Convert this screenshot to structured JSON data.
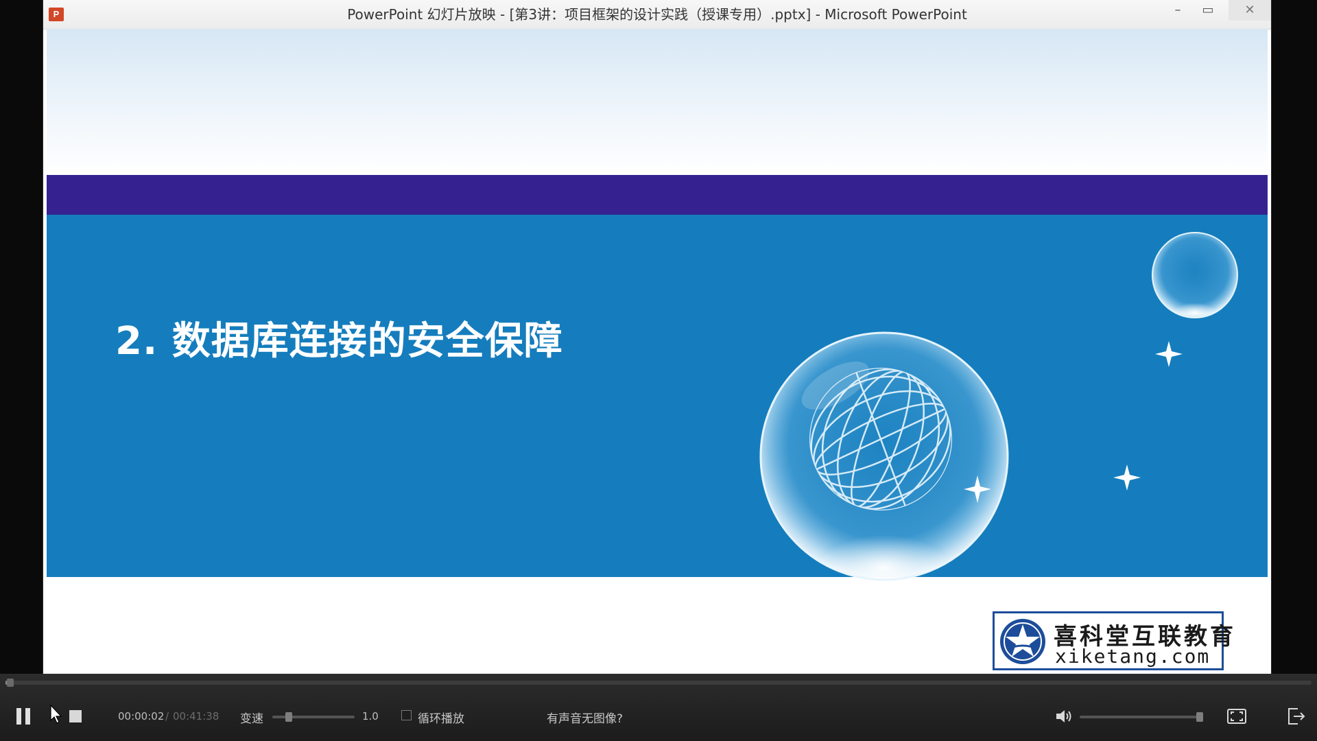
{
  "window": {
    "app_icon_letter": "P",
    "title": "PowerPoint 幻灯片放映 - [第3讲：项目框架的设计实践（授课专用）.pptx] - Microsoft PowerPoint",
    "minimize_glyph": "–",
    "maximize_glyph": "▭",
    "close_glyph": "✕"
  },
  "slide": {
    "title": "2. 数据库连接的安全保障",
    "colors": {
      "band": "#352290",
      "panel": "#157dbd"
    }
  },
  "logo": {
    "cn_text": "喜科堂互联教育",
    "en_text": "xiketang.com"
  },
  "player": {
    "progress_fraction": 0.001,
    "time_current": "00:00:02",
    "time_separator": "/",
    "time_total": "00:41:38",
    "speed_label": "变速",
    "speed_value": "1.0",
    "speed_fraction": 0.2,
    "loop_label": "循环播放",
    "loop_checked": false,
    "help_link": "有声音无图像?",
    "volume_fraction": 1.0,
    "icons": [
      "pause-icon",
      "stop-icon",
      "volume-icon",
      "fullscreen-icon",
      "exit-icon"
    ]
  }
}
